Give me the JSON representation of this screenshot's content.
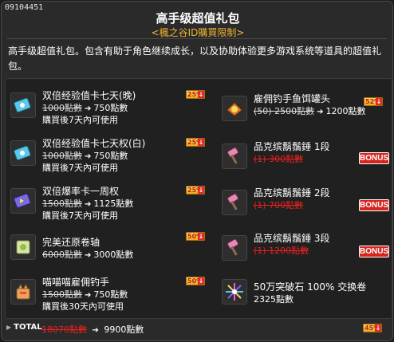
{
  "header": {
    "id": "09104451",
    "title": "高手级超值礼包",
    "subtitle": "<楓之谷ID購買限制>"
  },
  "description": "高手级超值礼包。包含有助于角色继续成长，以及协助体验更多游戏系统等道具的超值礼包。",
  "left_items": [
    {
      "name": "双倍经验值卡七天(晚)",
      "old_price": "1000點數",
      "new_price": "750點數",
      "condition": "購買後7天內可使用",
      "discount": "25%",
      "icon": "blue-card-icon"
    },
    {
      "name": "双倍经验值卡七天权(白)",
      "old_price": "1000點數",
      "new_price": "750點數",
      "condition": "購買後7天內可使用",
      "discount": "25%",
      "icon": "blue-card-icon"
    },
    {
      "name": "双倍爆率卡一周权",
      "old_price": "1500點數",
      "new_price": "1125點數",
      "condition": "購買後7天內可使用",
      "discount": "25%",
      "icon": "purple-card-icon"
    },
    {
      "name": "完美还原卷轴",
      "old_price": "6000點數",
      "new_price": "3000點數",
      "condition": "",
      "discount": "50%",
      "icon": "scroll-icon"
    },
    {
      "name": "喵喵喵雇佣钓手",
      "old_price": "1500點數",
      "new_price": "750點數",
      "condition": "購買後30天內可使用",
      "discount": "50%",
      "icon": "cat-fisher-icon"
    }
  ],
  "right_items": [
    {
      "name": "雇佣钓手鱼饵罐头",
      "old_price": "(50) 2500點數",
      "new_price": "1200點數",
      "old_red": false,
      "badge": "52%",
      "badge_type": "discount",
      "icon": "bait-can-icon"
    },
    {
      "name": "品克缤鬍鬚錘 1段",
      "old_price": "(1) 300點數",
      "new_price": "",
      "old_red": true,
      "badge": "BONUS",
      "badge_type": "bonus",
      "icon": "pink-hammer-icon"
    },
    {
      "name": "品克缤鬍鬚錘 2段",
      "old_price": "(1) 700點數",
      "new_price": "",
      "old_red": true,
      "badge": "BONUS",
      "badge_type": "bonus",
      "icon": "pink-hammer-icon"
    },
    {
      "name": "品克缤鬍鬚錘 3段",
      "old_price": "(1) 1200點數",
      "new_price": "",
      "old_red": true,
      "badge": "BONUS",
      "badge_type": "bonus",
      "icon": "pink-hammer-icon"
    },
    {
      "name": "50万突破石 100% 交换卷",
      "old_price": "",
      "new_price": "2325點數",
      "old_red": false,
      "badge": "",
      "badge_type": "none",
      "icon": "breakthrough-stone-icon"
    }
  ],
  "total": {
    "label": "TOTAL",
    "old_price": "18070點數",
    "new_price": "9900點數",
    "discount": "45%"
  },
  "colors": {
    "accent": "#f1b42f",
    "strike_red": "#e8211f",
    "bonus_red": "#d6251f",
    "background": "#2a2a2a"
  }
}
